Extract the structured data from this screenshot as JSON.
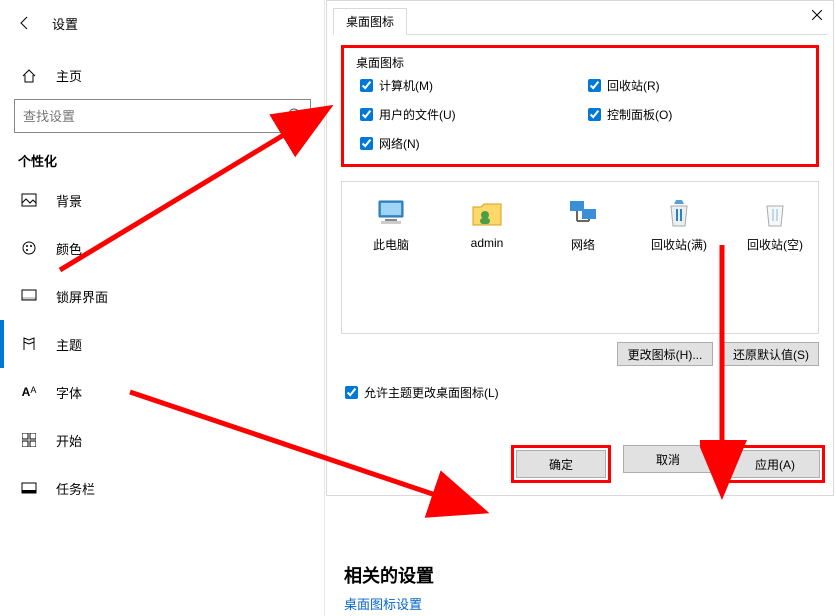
{
  "header": {
    "title": "设置"
  },
  "home": {
    "label": "主页"
  },
  "search": {
    "placeholder": "查找设置"
  },
  "section": {
    "title": "个性化"
  },
  "nav": [
    {
      "label": "背景"
    },
    {
      "label": "颜色"
    },
    {
      "label": "锁屏界面"
    },
    {
      "label": "主题"
    },
    {
      "label": "字体"
    },
    {
      "label": "开始"
    },
    {
      "label": "任务栏"
    }
  ],
  "dialog": {
    "tab": "桌面图标",
    "group_title": "桌面图标",
    "checks": {
      "computer": "计算机(M)",
      "recycle": "回收站(R)",
      "userfiles": "用户的文件(U)",
      "control": "控制面板(O)",
      "network": "网络(N)"
    },
    "icons": {
      "thispc": "此电脑",
      "admin": "admin",
      "network": "网络",
      "recycle_full": "回收站(满)",
      "recycle_empty": "回收站(空)"
    },
    "change_icon": "更改图标(H)...",
    "restore_default": "还原默认值(S)",
    "allow_theme": "允许主题更改桌面图标(L)",
    "ok": "确定",
    "cancel": "取消",
    "apply": "应用(A)"
  },
  "related": {
    "title": "相关的设置",
    "link": "桌面图标设置"
  }
}
